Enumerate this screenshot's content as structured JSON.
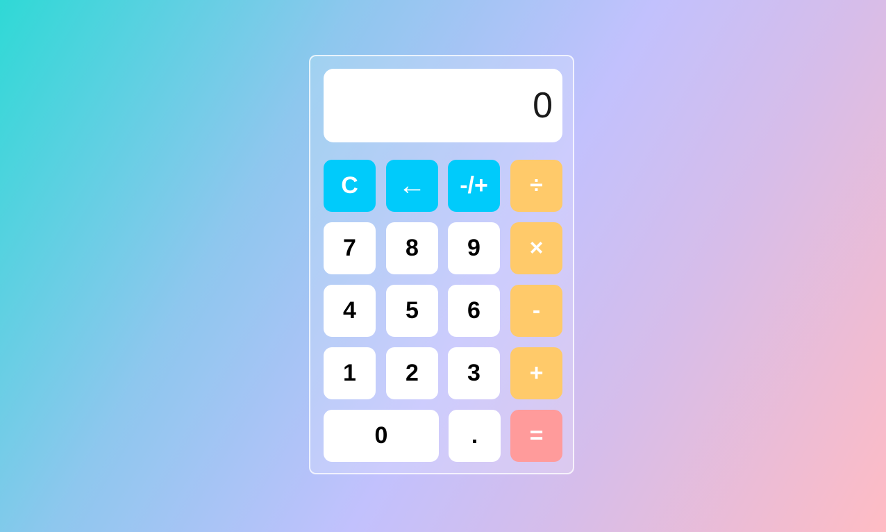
{
  "display": {
    "value": "0"
  },
  "keys": {
    "clear": "C",
    "backspace": "←",
    "negate": "-/+",
    "divide": "÷",
    "seven": "7",
    "eight": "8",
    "nine": "9",
    "multiply": "×",
    "four": "4",
    "five": "5",
    "six": "6",
    "subtract": "-",
    "one": "1",
    "two": "2",
    "three": "3",
    "add": "+",
    "zero": "0",
    "decimal": ".",
    "equals": "="
  },
  "colors": {
    "function_key": "#00cbfb",
    "operator_key": "#ffca6a",
    "equals_key": "#ff9b9b",
    "number_key": "#ffffff"
  }
}
